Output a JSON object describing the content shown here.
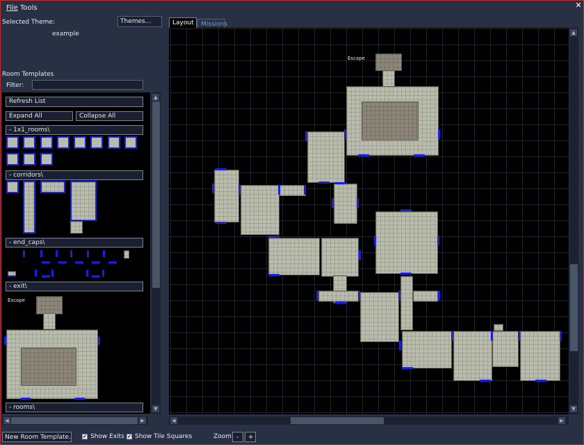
{
  "menu": {
    "file": "File",
    "tools": "Tools"
  },
  "close_glyph": "✕",
  "theme": {
    "label": "Selected Theme:",
    "themes_button": "Themes...",
    "name": "example"
  },
  "templates": {
    "heading": "Room Templates",
    "filter_label": "Filter:",
    "filter_value": "",
    "refresh": "Refresh List",
    "expand_all": "Expand All",
    "collapse_all": "Collapse All",
    "folders": [
      "- 1x1_rooms\\",
      "- corridors\\",
      "- end_caps\\",
      "- exit\\",
      "- rooms\\"
    ],
    "exit_preview_label": "Escape"
  },
  "tabs": {
    "layout": "Layout",
    "missions": "Missions"
  },
  "map": {
    "escape_label": "Escape"
  },
  "bottom": {
    "new_room": "New Room Template...",
    "show_exits": "Show Exits",
    "show_exits_checked": true,
    "show_tiles": "Show Tile Squares",
    "show_tiles_checked": true,
    "zoom_label": "Zoom:",
    "zoom_minus": "-",
    "zoom_plus": "+"
  },
  "colors": {
    "frame": "#c42a2a",
    "exit": "#1a1fd8",
    "background": "#283143"
  }
}
